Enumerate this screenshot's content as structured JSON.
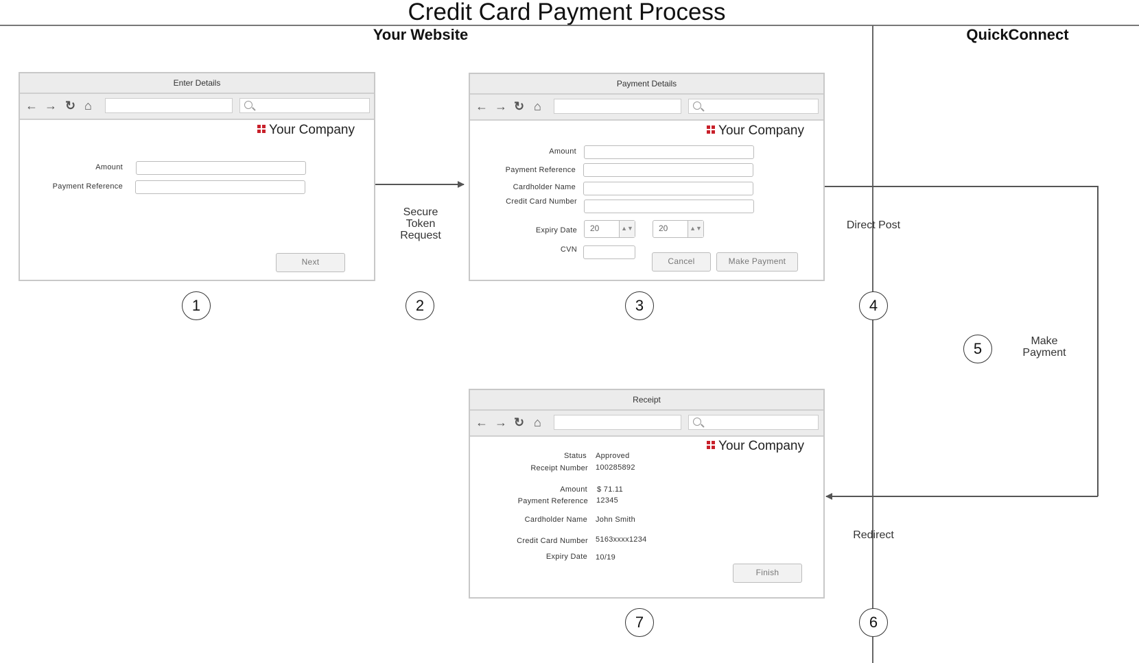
{
  "title": "Credit Card Payment Process",
  "lanes": {
    "left": "Your Website",
    "right": "QuickConnect"
  },
  "brand": {
    "name": "Your Company",
    "accent_color": "#c8202a",
    "icon": "grid-logo-icon"
  },
  "browser_nav_icons": [
    "back-arrow-icon",
    "forward-arrow-icon",
    "refresh-icon",
    "home-icon",
    "search-icon"
  ],
  "windows": {
    "enter_details": {
      "title": "Enter Details",
      "fields": [
        {
          "label": "Amount",
          "value": ""
        },
        {
          "label": "Payment Reference",
          "value": ""
        }
      ],
      "next_button": "Next"
    },
    "payment_details": {
      "title": "Payment Details",
      "fields": [
        {
          "label": "Amount",
          "value": ""
        },
        {
          "label": "Payment Reference",
          "value": ""
        },
        {
          "label": "Cardholder Name",
          "value": ""
        },
        {
          "label": "Credit Card Number",
          "value": ""
        }
      ],
      "expiry_label": "Expiry Date",
      "expiry_month": "20",
      "expiry_year": "20",
      "cvn_label": "CVN",
      "cancel_button": "Cancel",
      "make_payment_button": "Make Payment"
    },
    "receipt": {
      "title": "Receipt",
      "rows": [
        {
          "label": "Status",
          "value": "Approved"
        },
        {
          "label": "Receipt Number",
          "value": "100285892"
        },
        {
          "label": "Amount",
          "value": "$ 71.11"
        },
        {
          "label": "Payment Reference",
          "value": "12345"
        },
        {
          "label": "Cardholder Name",
          "value": "John Smith"
        },
        {
          "label": "Credit Card Number",
          "value": "5163xxxx1234"
        },
        {
          "label": "Expiry Date",
          "value": "10/19"
        }
      ],
      "finish_button": "Finish"
    }
  },
  "flow_labels": {
    "secure_token": "Secure\nToken\nRequest",
    "direct_post": "Direct Post",
    "make_payment": "Make\nPayment",
    "redirect": "Redirect"
  },
  "steps": [
    "1",
    "2",
    "3",
    "4",
    "5",
    "6",
    "7"
  ]
}
